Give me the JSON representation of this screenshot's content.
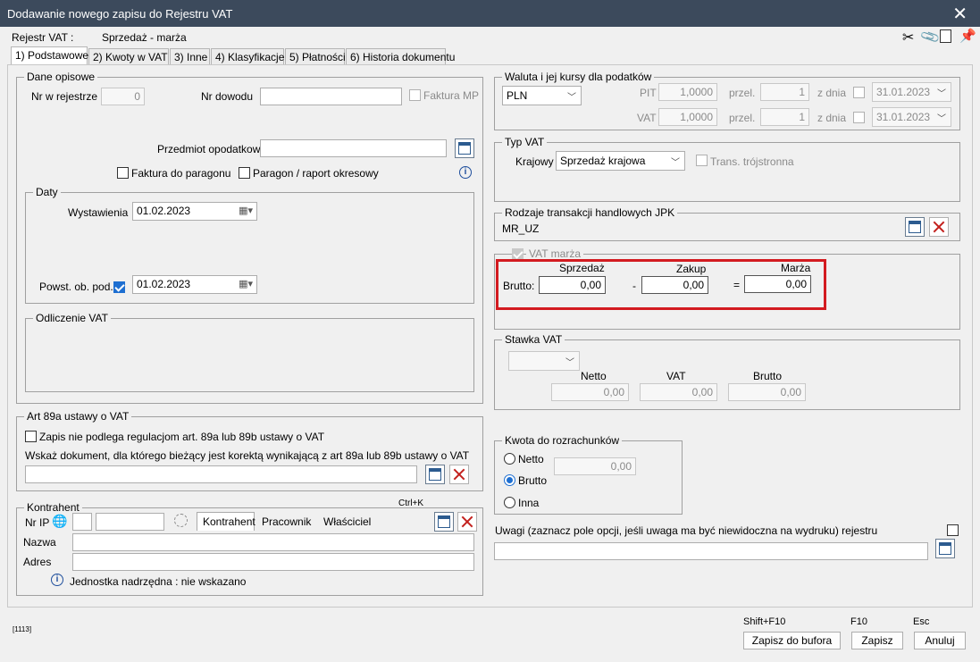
{
  "window": {
    "title": "Dodawanie nowego zapisu do Rejestru VAT"
  },
  "header": {
    "register_label": "Rejestr VAT :",
    "register_value": "Sprzedaż - marża"
  },
  "tabs": [
    {
      "label": "1) Podstawowe",
      "active": true
    },
    {
      "label": "2) Kwoty w VAT",
      "active": false
    },
    {
      "label": "3) Inne",
      "active": false
    },
    {
      "label": "4) Klasyfikacje",
      "active": false
    },
    {
      "label": "5) Płatności",
      "active": false
    },
    {
      "label": "6) Historia dokumentu",
      "active": false
    }
  ],
  "dane_opisowe": {
    "legend": "Dane opisowe",
    "nr_w_rejestrze_label": "Nr w rejestrze",
    "nr_w_rejestrze_value": "0",
    "nr_dowodu_label": "Nr dowodu",
    "nr_dowodu_value": "",
    "faktura_mp_label": "Faktura MP",
    "przedmiot_label": "Przedmiot opodatkow.",
    "przedmiot_value": "",
    "faktura_do_paragonu_label": "Faktura do paragonu",
    "paragon_label": "Paragon / raport okresowy"
  },
  "daty": {
    "legend": "Daty",
    "wystawienia_label": "Wystawienia",
    "wystawienia_value": "01.02.2023",
    "powst_label": "Powst. ob. pod. :",
    "powst_value": "01.02.2023"
  },
  "odliczenie": {
    "legend": "Odliczenie VAT"
  },
  "art89a": {
    "legend": "Art 89a ustawy o VAT",
    "checkbox_label": "Zapis nie podlega regulacjom art. 89a lub 89b ustawy o VAT",
    "wskaz_label": "Wskaż dokument, dla którego bieżący jest korektą wynikającą z art 89a lub 89b ustawy o VAT",
    "document_value": ""
  },
  "kontrahent": {
    "legend": "Kontrahent",
    "shortcut": "Ctrl+K",
    "nr_ip_label": "Nr IP",
    "tab_kontrahent": "Kontrahent",
    "tab_pracownik": "Pracownik",
    "tab_wlasciciel": "Właściciel",
    "nazwa_label": "Nazwa",
    "adres_label": "Adres",
    "jednostka_text": "Jednostka nadrzędna : nie wskazano"
  },
  "waluta": {
    "legend": "Waluta i jej kursy dla podatków",
    "currency": "PLN",
    "pit_label": "PIT",
    "pit_rate": "1,0000",
    "przel_label": "przel.",
    "pit_przel": "1",
    "z_dnia_label": "z dnia",
    "pit_date": "31.01.2023",
    "vat_label": "VAT",
    "vat_rate": "1,0000",
    "vat_przel": "1",
    "vat_date": "31.01.2023"
  },
  "typ_vat": {
    "legend": "Typ VAT",
    "krajowy_label": "Krajowy",
    "krajowy_value": "Sprzedaż krajowa",
    "trans_label": "Trans. trójstronna"
  },
  "jpk": {
    "legend": "Rodzaje transakcji handlowych JPK",
    "value": "MR_UZ"
  },
  "vat_marza": {
    "legend": "VAT marża",
    "sprzedaz_label": "Sprzedaż",
    "zakup_label": "Zakup",
    "marza_label": "Marża",
    "brutto_label": "Brutto:",
    "minus": "-",
    "equals": "=",
    "sprzedaz_value": "0,00",
    "zakup_value": "0,00",
    "marza_value": "0,00"
  },
  "stawka": {
    "legend": "Stawka VAT",
    "netto_label": "Netto",
    "vat_label": "VAT",
    "brutto_label": "Brutto",
    "netto_value": "0,00",
    "vat_value": "0,00",
    "brutto_value": "0,00"
  },
  "kwota": {
    "legend": "Kwota do rozrachunków",
    "netto_label": "Netto",
    "brutto_label": "Brutto",
    "inna_label": "Inna",
    "value": "0,00"
  },
  "uwagi": {
    "label": "Uwagi  (zaznacz pole opcji, jeśli uwaga ma być niewidoczna na wydruku) rejestru",
    "value": ""
  },
  "footer": {
    "code": "[1113]",
    "shortcut_bufor": "Shift+F10",
    "shortcut_zapisz": "F10",
    "shortcut_anuluj": "Esc",
    "btn_bufor": "Zapisz do bufora",
    "btn_zapisz": "Zapisz",
    "btn_anuluj": "Anuluj"
  }
}
